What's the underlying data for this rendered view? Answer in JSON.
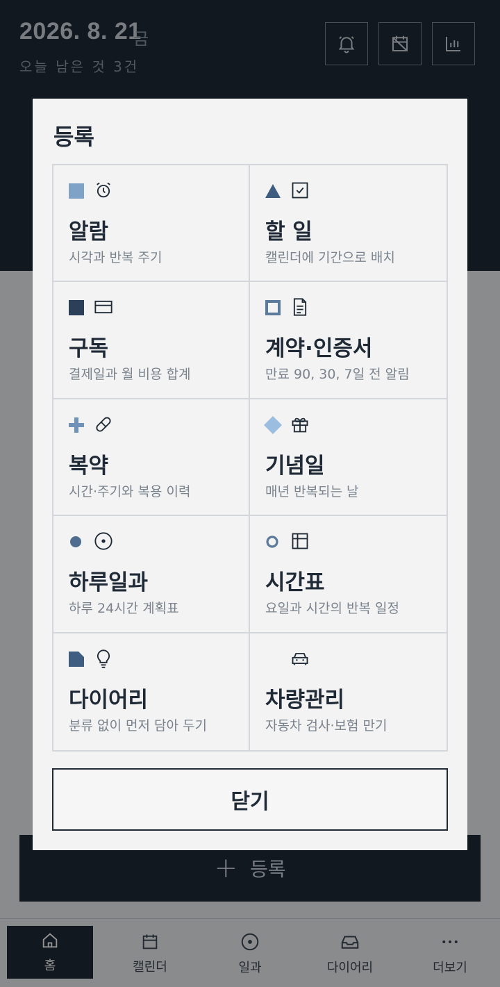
{
  "header": {
    "date": "2026. 8. 21",
    "weekday": "금",
    "remaining": "오늘 남은 것 3건",
    "icons": [
      "alarm-icon",
      "calendar-off-icon",
      "bar-chart-icon"
    ]
  },
  "background": {
    "register_label": "등록"
  },
  "modal": {
    "title": "등록",
    "close_label": "닫기",
    "items": [
      {
        "title": "알람",
        "subtitle": "시각과 반복 주기",
        "marker": "square",
        "marker_color": "#7fa3c6",
        "icon": "alarm-clock-icon"
      },
      {
        "title": "할 일",
        "subtitle": "캘린더에 기간으로 배치",
        "marker": "triangle",
        "marker_color": "#3e5d80",
        "icon": "checkbox-icon"
      },
      {
        "title": "구독",
        "subtitle": "결제일과 월 비용 합계",
        "marker": "square",
        "marker_color": "#2b3f58",
        "icon": "credit-card-icon"
      },
      {
        "title": "계약·인증서",
        "subtitle": "만료 90, 30, 7일 전 알림",
        "marker": "hollow-square",
        "marker_color": "#5c7a9c",
        "icon": "document-icon"
      },
      {
        "title": "복약",
        "subtitle": "시간·주기와 복용 이력",
        "marker": "plus",
        "marker_color": "#6f93b8",
        "icon": "pill-icon"
      },
      {
        "title": "기념일",
        "subtitle": "매년 반복되는 날",
        "marker": "diamond",
        "marker_color": "#9bbde0",
        "icon": "gift-icon"
      },
      {
        "title": "하루일과",
        "subtitle": "하루 24시간 계획표",
        "marker": "dot",
        "marker_color": "#4f6d91",
        "icon": "target-circle-icon"
      },
      {
        "title": "시간표",
        "subtitle": "요일과 시간의 반복 일정",
        "marker": "ring",
        "marker_color": "#5c7a9c",
        "icon": "table-grid-icon"
      },
      {
        "title": "다이어리",
        "subtitle": "분류 없이 먼저 담아 두기",
        "marker": "folded-square",
        "marker_color": "#3e5d80",
        "icon": "lightbulb-icon"
      },
      {
        "title": "차량관리",
        "subtitle": "자동차 검사·보험 만기",
        "marker": "none",
        "marker_color": "",
        "icon": "car-icon"
      }
    ]
  },
  "nav": {
    "items": [
      {
        "label": "홈",
        "icon": "home-icon"
      },
      {
        "label": "캘린더",
        "icon": "calendar-icon"
      },
      {
        "label": "일과",
        "icon": "target-circle-icon"
      },
      {
        "label": "다이어리",
        "icon": "inbox-icon"
      },
      {
        "label": "더보기",
        "icon": "more-dots-icon"
      }
    ]
  }
}
